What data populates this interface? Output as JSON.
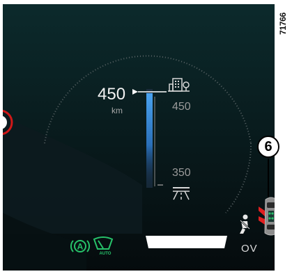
{
  "figure_code": "71766",
  "range": {
    "value": "450",
    "unit": "km"
  },
  "scale": {
    "upper_tick": "450",
    "lower_tick": "350"
  },
  "icons": {
    "destination": "city-buildings-icon",
    "highway": "highway-road-icon",
    "auto_hold": "auto-hold-icon",
    "wiper_auto": "auto-wiper-icon",
    "seatbelt": "seatbelt-warning-icon",
    "car_doors": "car-doors-open-icon"
  },
  "status": {
    "ov_label": "OV"
  },
  "callout": {
    "number": "6"
  },
  "colors": {
    "background": "#050b0d",
    "green_indicator": "#27c26a",
    "red_warning": "#e02020",
    "blue_bar": "#3a8fd8"
  }
}
